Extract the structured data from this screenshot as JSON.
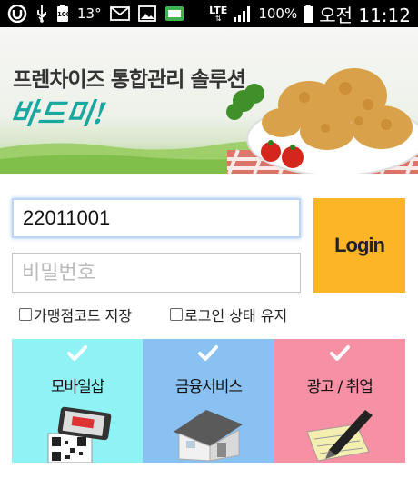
{
  "status_bar": {
    "battery_small": "100",
    "temperature": "13°",
    "network": "LTE",
    "battery_percent": "100%",
    "time": "오전 11:12",
    "icons": [
      "u-app-icon",
      "usb-icon",
      "battery-small-icon",
      "email-icon",
      "image-icon",
      "message-icon",
      "lte-icon",
      "signal-icon",
      "battery-icon"
    ]
  },
  "banner": {
    "title": "프렌차이즈 통합관리 솔루션",
    "brand": "바드미!"
  },
  "login": {
    "id_value": "22011001",
    "pw_placeholder": "비밀번호",
    "login_label": "Login",
    "save_code_label": "가맹점코드 저장",
    "keep_login_label": "로그인 상태 유지"
  },
  "tiles": [
    {
      "label": "모바일샵",
      "color": "#8ff3f5",
      "icon": "qr-phone-icon"
    },
    {
      "label": "금융서비스",
      "color": "#89c2f2",
      "icon": "house-icon"
    },
    {
      "label": "광고 / 취업",
      "color": "#f690a5",
      "icon": "pen-paper-icon"
    }
  ],
  "colors": {
    "login_button": "#fbb526",
    "brand": "#19a7a0"
  }
}
